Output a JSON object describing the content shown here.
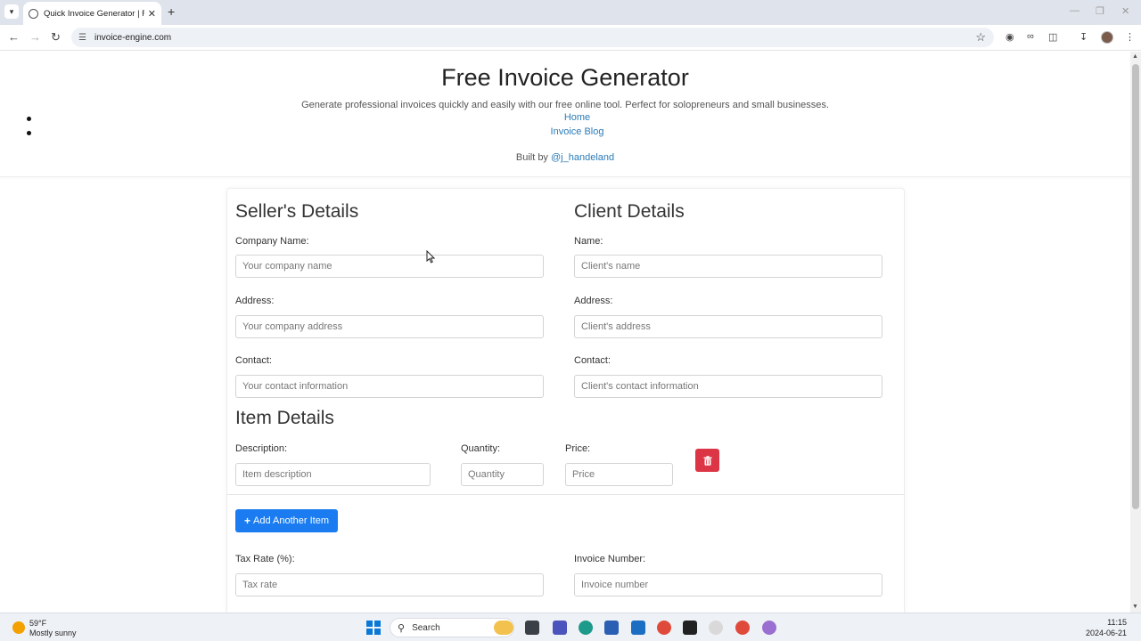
{
  "browser": {
    "tab_title": "Quick Invoice Generator | Free I",
    "url": "invoice-engine.com"
  },
  "header": {
    "title": "Free Invoice Generator",
    "subtitle": "Generate professional invoices quickly and easily with our free online tool. Perfect for solopreneurs and small businesses.",
    "nav": [
      "Home",
      "Invoice Blog"
    ],
    "built_by_prefix": "Built by",
    "built_by_handle": "@j_handeland"
  },
  "seller": {
    "heading": "Seller's Details",
    "company_label": "Company Name:",
    "company_placeholder": "Your company name",
    "address_label": "Address:",
    "address_placeholder": "Your company address",
    "contact_label": "Contact:",
    "contact_placeholder": "Your contact information"
  },
  "client": {
    "heading": "Client Details",
    "name_label": "Name:",
    "name_placeholder": "Client's name",
    "address_label": "Address:",
    "address_placeholder": "Client's address",
    "contact_label": "Contact:",
    "contact_placeholder": "Client's contact information"
  },
  "items": {
    "heading": "Item Details",
    "description_label": "Description:",
    "description_placeholder": "Item description",
    "quantity_label": "Quantity:",
    "quantity_placeholder": "Quantity",
    "price_label": "Price:",
    "price_placeholder": "Price",
    "add_button": "Add Another Item"
  },
  "invoice": {
    "tax_label": "Tax Rate (%):",
    "tax_placeholder": "Tax rate",
    "number_label": "Invoice Number:",
    "number_placeholder": "Invoice number"
  },
  "taskbar": {
    "temperature": "59°F",
    "weather": "Mostly sunny",
    "search": "Search",
    "time": "11:15",
    "date": "2024-06-21"
  },
  "colors": {
    "link": "#2a7bb8",
    "primary_button": "#1a7cf0",
    "danger_button": "#dc3545"
  }
}
